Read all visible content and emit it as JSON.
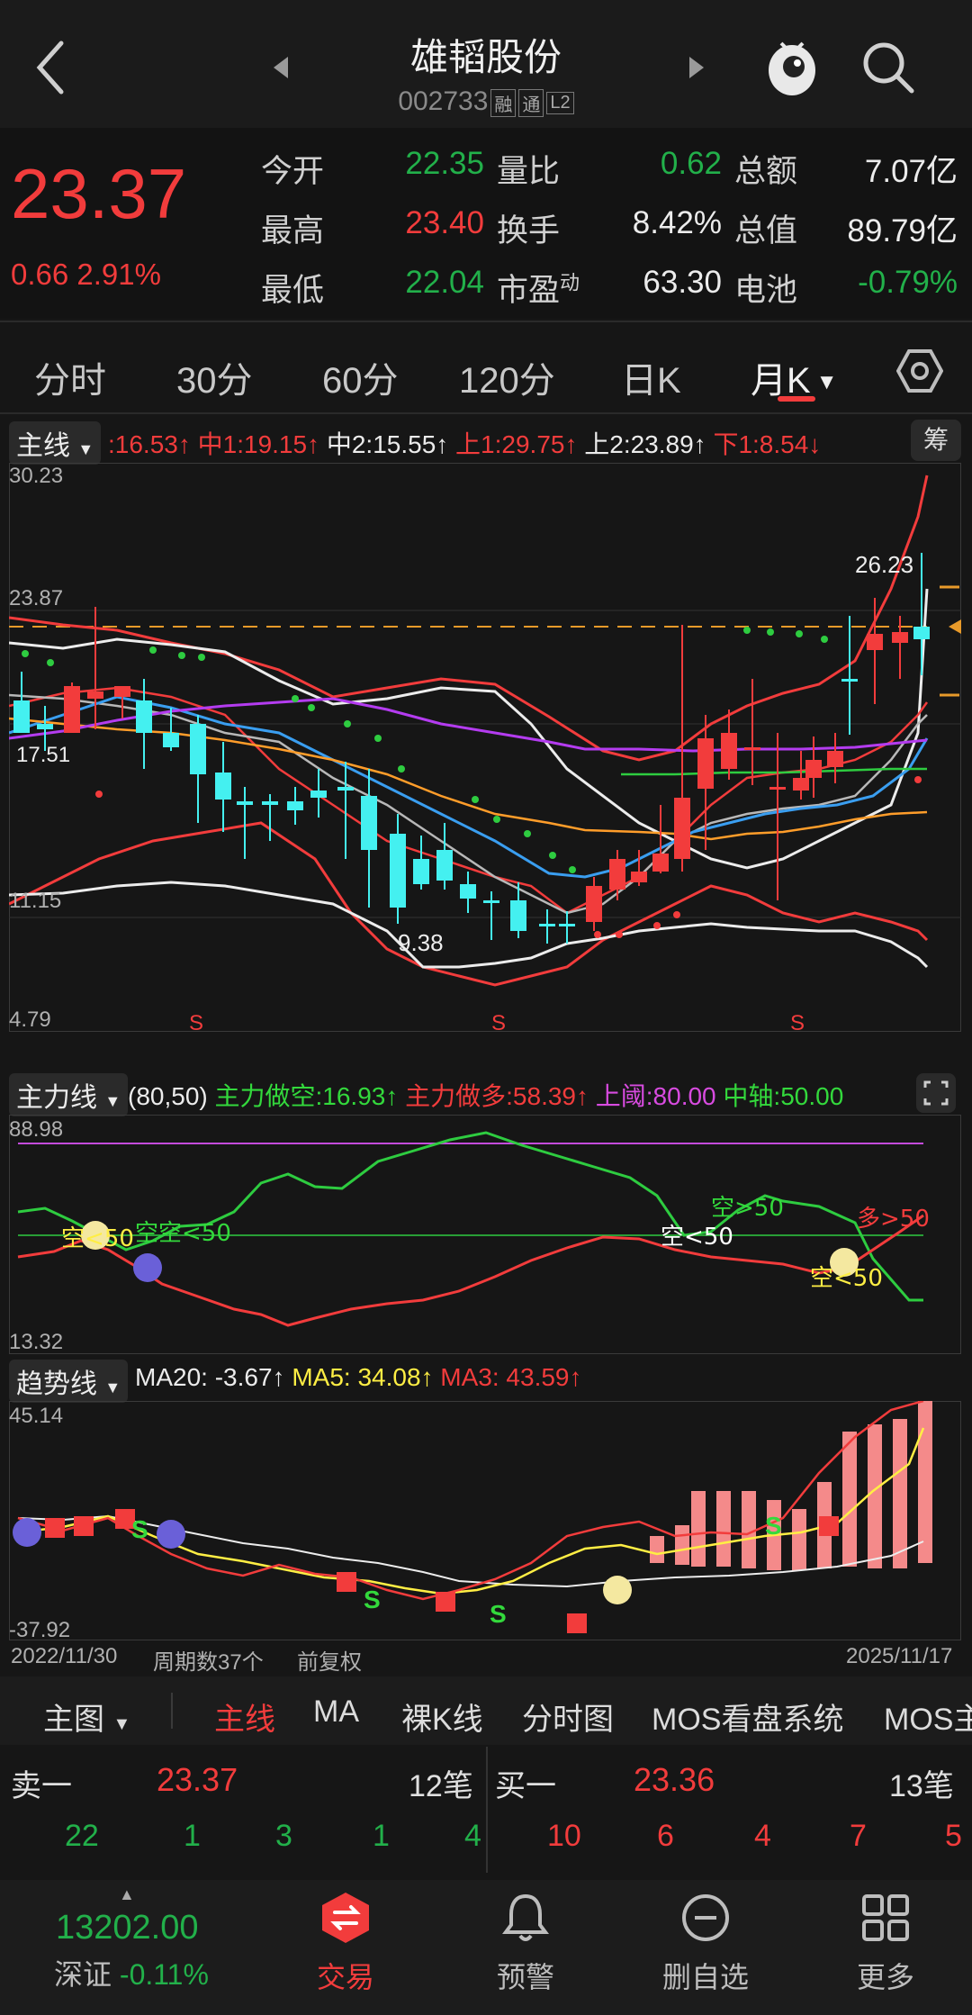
{
  "header": {
    "title": "雄韬股份",
    "code": "002733",
    "tags": [
      "融",
      "通",
      "L2"
    ]
  },
  "quote": {
    "price": "23.37",
    "change": "0.66",
    "change_pct": "2.91%",
    "rows": [
      [
        {
          "label": "今开",
          "value": "22.35",
          "color": "green"
        },
        {
          "label": "量比",
          "value": "0.62",
          "color": "green"
        },
        {
          "label": "总额",
          "value": "7.07亿",
          "color": "white"
        }
      ],
      [
        {
          "label": "最高",
          "value": "23.40",
          "color": "red"
        },
        {
          "label": "换手",
          "value": "8.42%",
          "color": "white"
        },
        {
          "label": "总值",
          "value": "89.79亿",
          "color": "white"
        }
      ],
      [
        {
          "label": "最低",
          "value": "22.04",
          "color": "green"
        },
        {
          "label": "市盈",
          "sup": "动",
          "value": "63.30",
          "color": "white"
        },
        {
          "label": "电池",
          "value": "-0.79%",
          "color": "green",
          "label_color": "orange"
        }
      ]
    ]
  },
  "tabs": [
    "分时",
    "30分",
    "60分",
    "120分",
    "日K",
    "月K"
  ],
  "main_chart": {
    "label": "主线",
    "values": [
      {
        "text": ":16.53↑",
        "color": "#f23c3c"
      },
      {
        "text": "中1:19.15↑",
        "color": "#f23c3c"
      },
      {
        "text": "中2:15.55↑",
        "color": "#ececec"
      },
      {
        "text": "上1:29.75↑",
        "color": "#f23c3c"
      },
      {
        "text": "上2:23.89↑",
        "color": "#ececec"
      },
      {
        "text": "下1:8.54↓",
        "color": "#f23c3c"
      }
    ],
    "chip_label": "筹",
    "y_top": "30.23",
    "y_mid": "23.87",
    "y_low": "11.15",
    "y_bottom": "4.79",
    "left_price": "17.51",
    "high_label": "26.23",
    "low_label": "9.38",
    "s_markers": [
      "S",
      "S",
      "S"
    ]
  },
  "force_chart": {
    "label": "主力线",
    "params": "(80,50)",
    "values": [
      {
        "text": "主力做空:16.93↑",
        "color": "#33d93c"
      },
      {
        "text": "主力做多:58.39↑",
        "color": "#f23c3c"
      },
      {
        "text": "上阈:80.00",
        "color": "#d84be0"
      },
      {
        "text": "中轴:50.00",
        "color": "#33d93c"
      }
    ],
    "y_top": "88.98",
    "y_bottom": "13.32",
    "annotations": [
      {
        "text": "空<50",
        "color": "#ffee44"
      },
      {
        "text": "空空<50",
        "color": "#33d93c"
      },
      {
        "text": "空<50",
        "color": "#ffffff"
      },
      {
        "text": "空>50",
        "color": "#33d93c"
      },
      {
        "text": "多>50",
        "color": "#f23c3c"
      },
      {
        "text": "空<50",
        "color": "#ffee44"
      }
    ]
  },
  "trend_chart": {
    "label": "趋势线",
    "values": [
      {
        "text": "MA20: -3.67↑",
        "color": "#ececec"
      },
      {
        "text": "MA5: 34.08↑",
        "color": "#ffee44"
      },
      {
        "text": "MA3: 43.59↑",
        "color": "#f23c3c"
      }
    ],
    "y_top": "45.14",
    "y_bottom": "-37.92"
  },
  "footer_info": {
    "start_date": "2022/11/30",
    "period_count": "周期数37个",
    "adjust": "前复权",
    "end_date": "2025/11/17"
  },
  "subbar": {
    "main_selector": "主图",
    "items": [
      "主线",
      "MA",
      "裸K线",
      "分时图",
      "MOS看盘系统",
      "MOS主"
    ]
  },
  "book": {
    "sell_label": "卖一",
    "sell_price": "23.37",
    "sell_count": "12笔",
    "buy_label": "买一",
    "buy_price": "23.36",
    "buy_count": "13笔",
    "sell_qty": [
      "22",
      "1",
      "3",
      "1",
      "4"
    ],
    "buy_qty": [
      "10",
      "6",
      "4",
      "7",
      "5"
    ]
  },
  "bottom_nav": {
    "index_value": "13202.00",
    "index_name": "深证",
    "index_change": "-0.11%",
    "items": [
      "交易",
      "预警",
      "删自选",
      "更多"
    ]
  },
  "colors": {
    "red": "#f23c3c",
    "green": "#22b04a",
    "cyan": "#44f0f0",
    "orange": "#ff8a1e"
  }
}
